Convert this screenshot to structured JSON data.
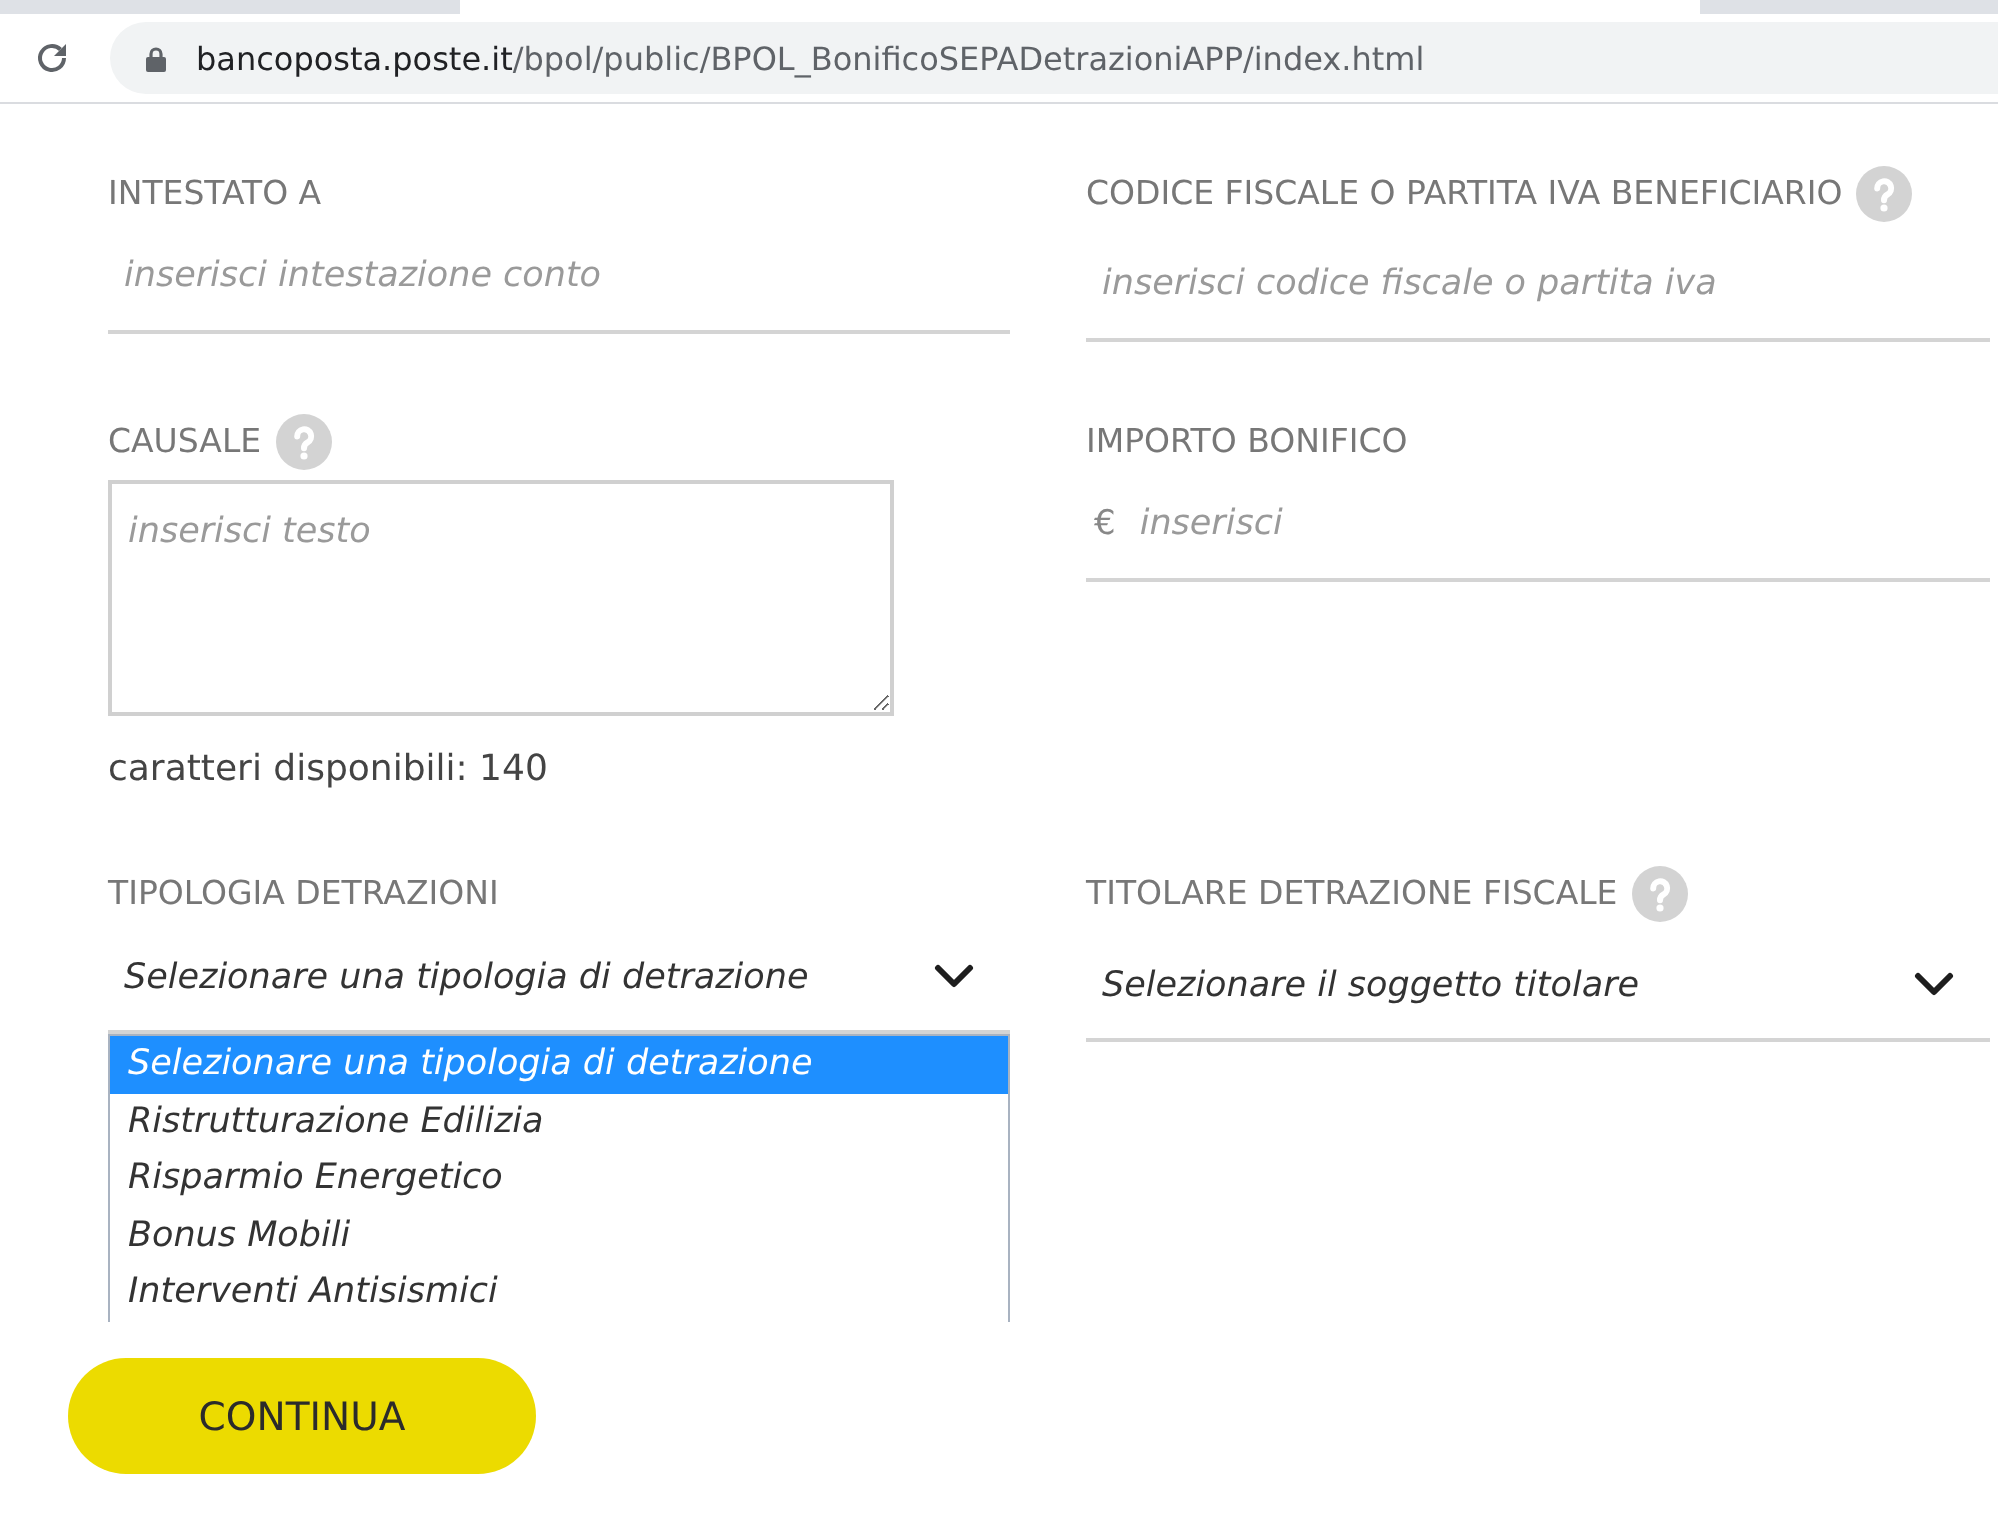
{
  "browser": {
    "url_host": "bancoposta.poste.it",
    "url_path": "/bpol/public/BPOL_BonificoSEPADetrazioniAPP/index.html"
  },
  "form": {
    "rows": [
      {
        "fields": [
          {
            "kind": "text",
            "label": "INTESTATO A",
            "help": false,
            "placeholder": "inserisci intestazione conto"
          },
          {
            "kind": "text",
            "label": "CODICE FISCALE O PARTITA IVA BENEFICIARIO",
            "help": true,
            "placeholder": "inserisci codice fiscale o partita iva"
          }
        ]
      },
      {
        "fields": [
          {
            "kind": "textarea",
            "label": "CAUSALE",
            "help": true,
            "placeholder": "inserisci testo",
            "counter": "caratteri disponibili: 140"
          },
          {
            "kind": "amount",
            "label": "IMPORTO BONIFICO",
            "help": false,
            "currency": "€",
            "placeholder": "inserisci"
          }
        ]
      },
      {
        "fields": [
          {
            "kind": "select",
            "label": "TIPOLOGIA DETRAZIONI",
            "help": false,
            "value": "Selezionare una tipologia di detrazione",
            "expanded": true,
            "options": [
              {
                "label": "Selezionare una tipologia di detrazione",
                "selected": true
              },
              {
                "label": "Ristrutturazione Edilizia",
                "selected": false
              },
              {
                "label": "Risparmio Energetico",
                "selected": false
              },
              {
                "label": "Bonus Mobili",
                "selected": false
              },
              {
                "label": "Interventi Antisismici",
                "selected": false
              }
            ]
          },
          {
            "kind": "select",
            "label": "TITOLARE DETRAZIONE FISCALE",
            "help": true,
            "value": "Selezionare il soggetto titolare",
            "expanded": false
          }
        ]
      }
    ],
    "submit_button": "CONTINUA"
  }
}
